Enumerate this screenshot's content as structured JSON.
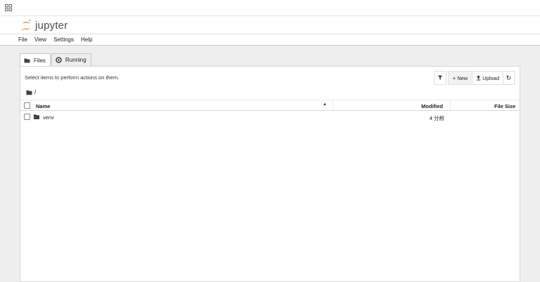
{
  "app": {
    "name": "jupyter"
  },
  "menu": [
    "File",
    "View",
    "Settings",
    "Help"
  ],
  "tabs": {
    "files": "Files",
    "running": "Running"
  },
  "toolbar": {
    "hint": "Select items to perform actions on them.",
    "new_label": "+ New",
    "upload_label": "Upload"
  },
  "breadcrumb": {
    "path": "/"
  },
  "table": {
    "headers": {
      "name": "Name",
      "modified": "Modified",
      "size": "File Size"
    },
    "rows": [
      {
        "name": "venv",
        "modified": "4 分前",
        "size": ""
      }
    ]
  },
  "colors": {
    "accent_orange": "#f37726",
    "text": "#212121",
    "background": "#eeeeee"
  }
}
